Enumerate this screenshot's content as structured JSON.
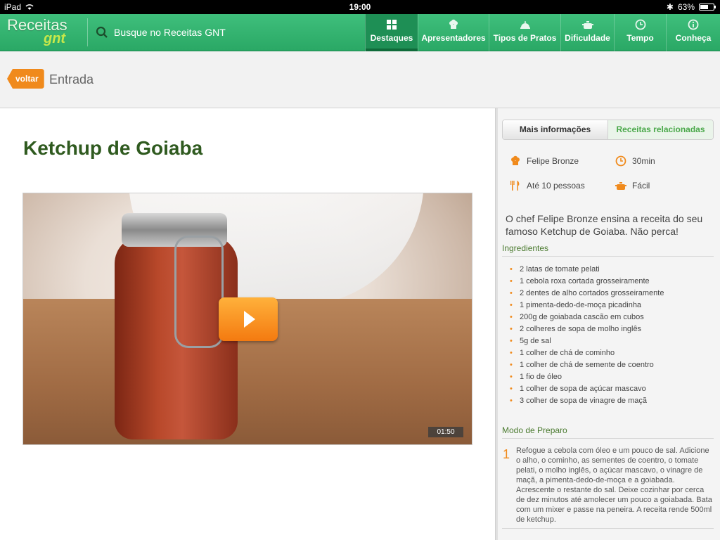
{
  "statusbar": {
    "device": "iPad",
    "time": "19:00",
    "battery": "63%",
    "battery_level": 0.63
  },
  "nav": {
    "logo_top": "Receitas",
    "logo_bottom": "gnt",
    "search_text": "Busque no Receitas GNT",
    "items": [
      {
        "label": "Destaques",
        "icon": "grid-icon"
      },
      {
        "label": "Apresentadores",
        "icon": "chef-hat-icon"
      },
      {
        "label": "Tipos de Pratos",
        "icon": "cloche-icon"
      },
      {
        "label": "Dificuldade",
        "icon": "pot-icon"
      },
      {
        "label": "Tempo",
        "icon": "clock-icon"
      },
      {
        "label": "Conheça",
        "icon": "info-icon"
      }
    ]
  },
  "subheader": {
    "back_label": "voltar",
    "section_title": "Entrada"
  },
  "recipe": {
    "title": "Ketchup de Goiaba",
    "video_duration": "01:50"
  },
  "panel": {
    "tabs": [
      "Mais informações",
      "Receitas relacionadas"
    ],
    "chef": "Felipe Bronze",
    "time": "30min",
    "servings": "Até 10 pessoas",
    "difficulty": "Fácil",
    "description": "O chef Felipe Bronze ensina a receita do seu famoso Ketchup de Goiaba. Não perca!",
    "ingredients_title": "Ingredientes",
    "ingredients": [
      "2 latas de tomate pelati",
      "1 cebola roxa cortada grosseiramente",
      "2 dentes de alho cortados grosseiramente",
      "1 pimenta-dedo-de-moça picadinha",
      "200g de goiabada cascão em cubos",
      "2 colheres de sopa de molho inglês",
      "5g de sal",
      "1 colher de chá de cominho",
      "1 colher de chá de semente de coentro",
      "1 fio de óleo",
      "1 colher de sopa de açúcar mascavo",
      "3 colher de sopa de vinagre de maçã"
    ],
    "method_title": "Modo de Preparo",
    "steps": [
      {
        "num": "1",
        "text": "Refogue a cebola com óleo e um pouco de sal. Adicione o alho, o cominho, as sementes de coentro, o tomate pelati, o molho inglês, o açúcar mascavo, o vinagre de maçã, a pimenta-dedo-de-moça e a goiabada. Acrescente o restante do sal. Deixe cozinhar por cerca de dez minutos até amolecer um pouco a goiabada. Bata com um mixer e passe na peneira. A receita rende 500ml de ketchup."
      }
    ]
  },
  "colors": {
    "nav_green": "#2aa865",
    "accent_orange": "#f08a1c",
    "title_green": "#2f5a1f",
    "link_green": "#4aa84a"
  }
}
